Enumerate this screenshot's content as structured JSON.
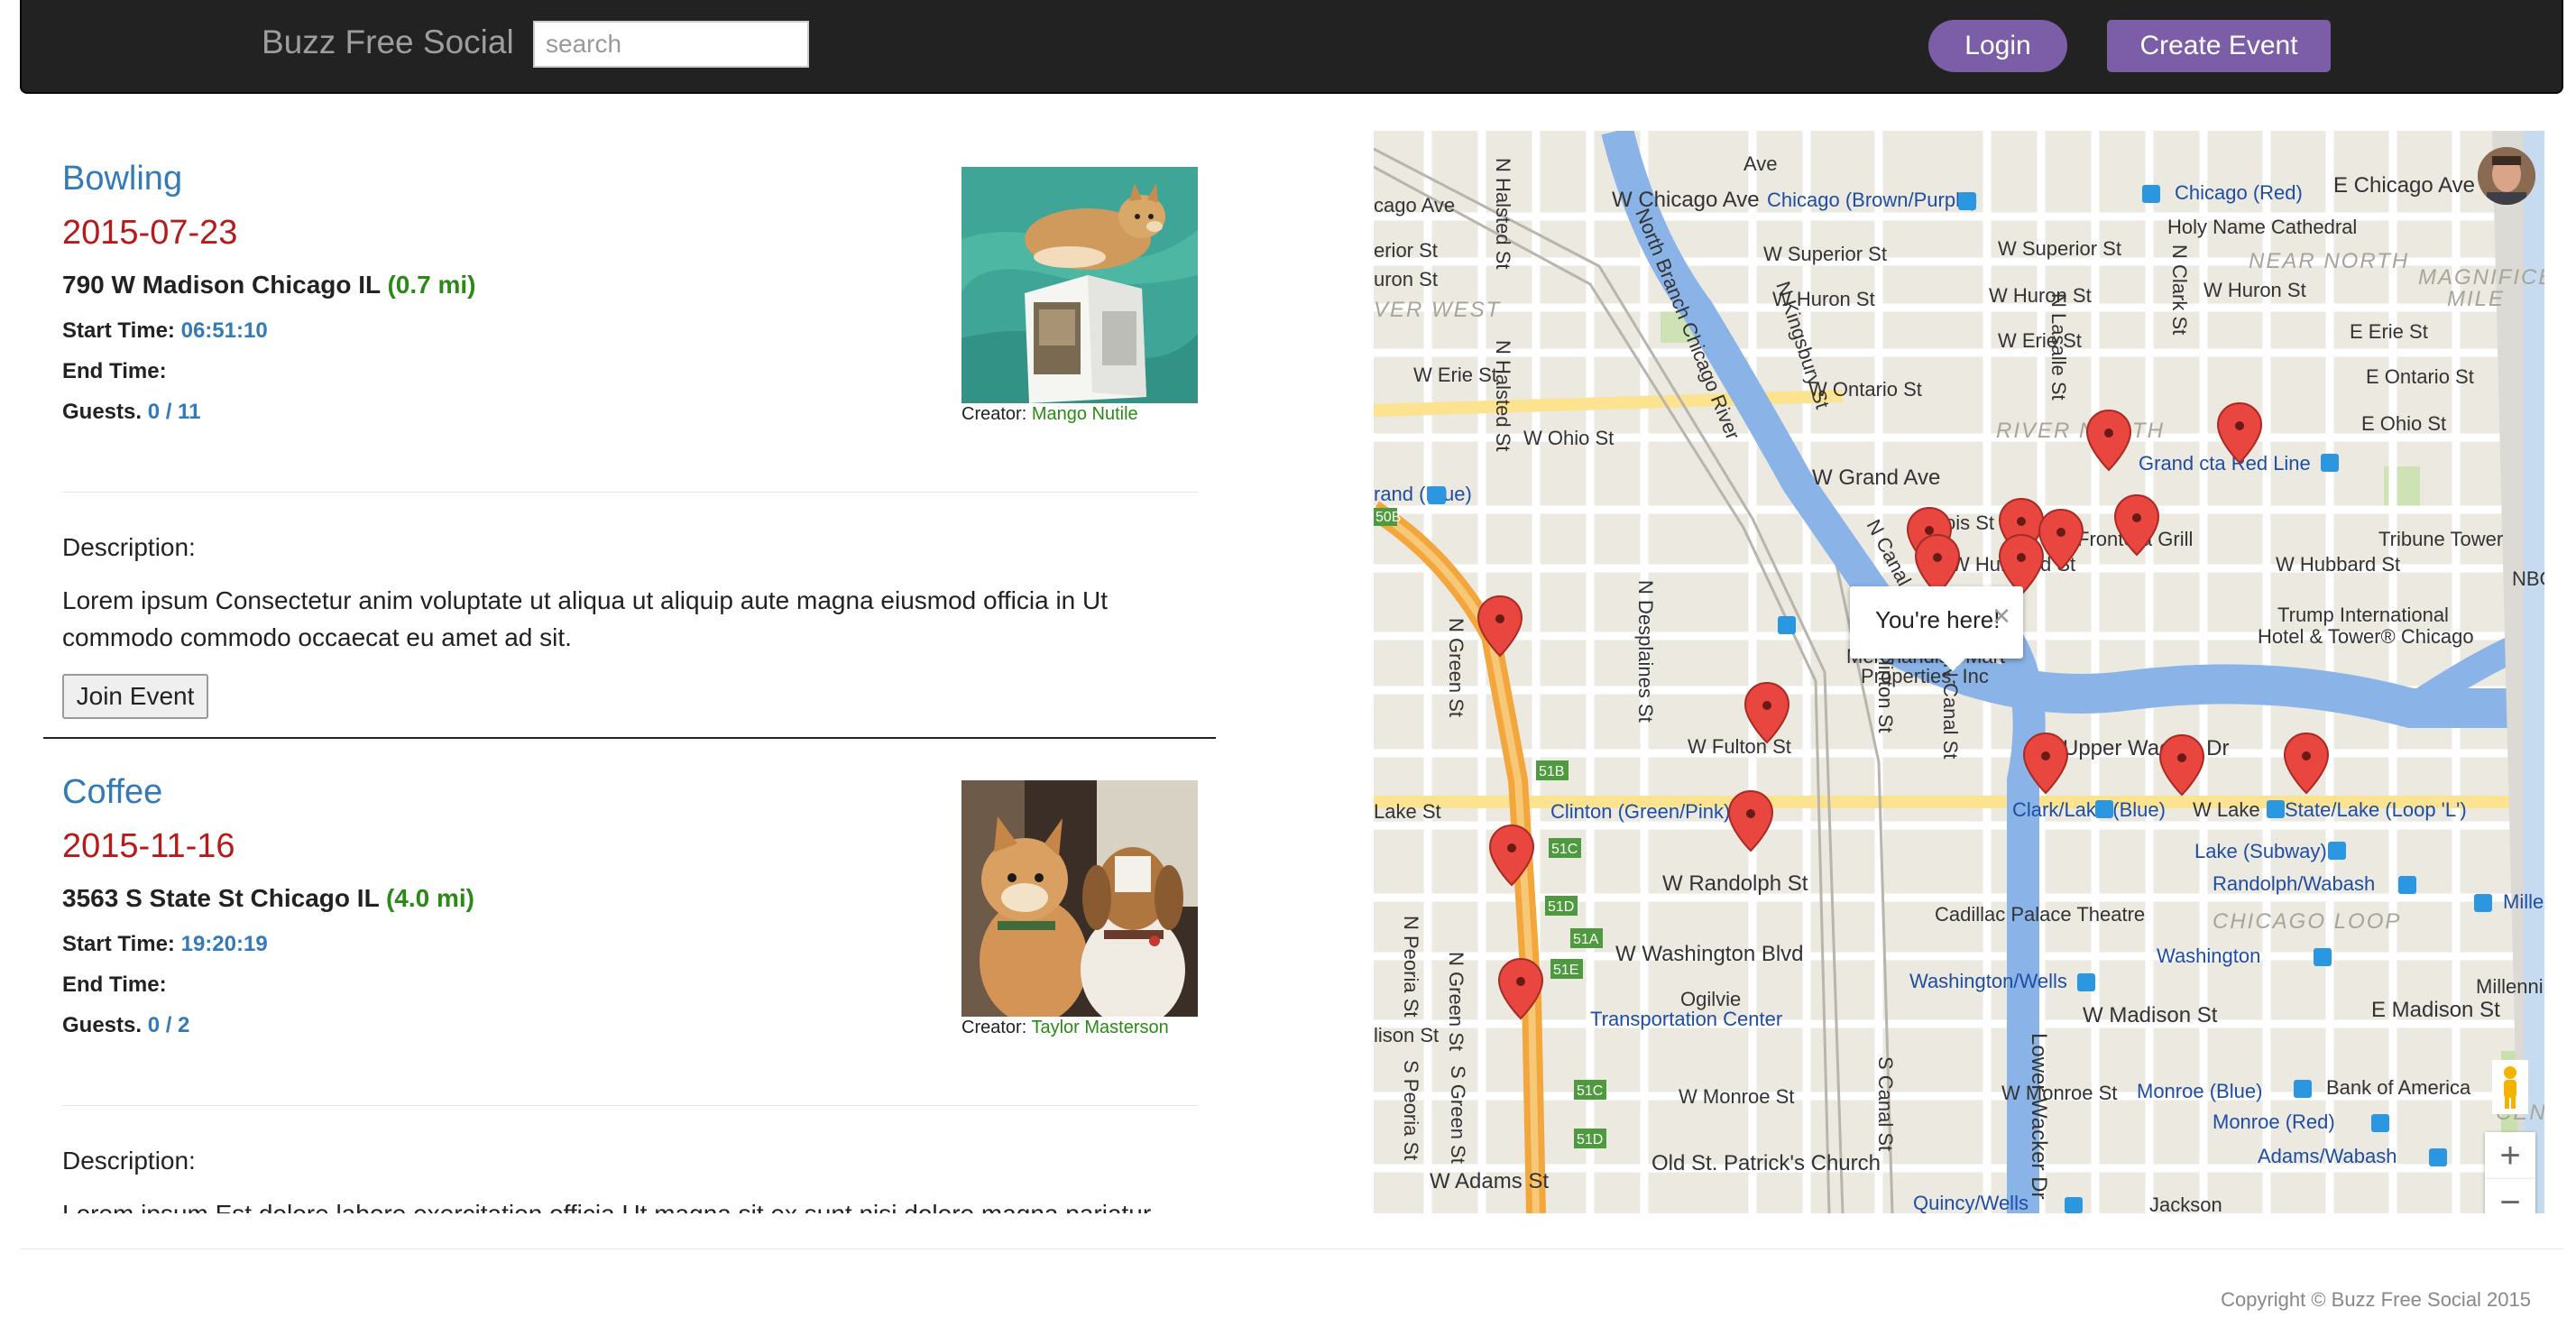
{
  "navbar": {
    "brand": "Buzz Free Social",
    "search_placeholder": "search",
    "login_label": "Login",
    "create_event_label": "Create Event"
  },
  "events": [
    {
      "title": "Bowling",
      "date": "2015-07-23",
      "address": "790 W Madison Chicago IL",
      "distance": "(0.7 mi)",
      "start_label": "Start Time:",
      "start_time": "06:51:10",
      "end_label": "End Time:",
      "end_time": "",
      "guests_label": "Guests.",
      "guests": "0 / 11",
      "creator_label": "Creator:",
      "creator": "Mango Nutile",
      "description_heading": "Description:",
      "description": "Lorem ipsum Consectetur anim voluptate ut aliqua ut aliquip aute magna eiusmod officia in Ut commodo commodo occaecat eu amet ad sit.",
      "join_label": "Join Event"
    },
    {
      "title": "Coffee",
      "date": "2015-11-16",
      "address": "3563 S State St Chicago IL",
      "distance": "(4.0 mi)",
      "start_label": "Start Time:",
      "start_time": "19:20:19",
      "end_label": "End Time:",
      "end_time": "",
      "guests_label": "Guests.",
      "guests": "0 / 2",
      "creator_label": "Creator:",
      "creator": "Taylor Masterson",
      "description_heading": "Description:",
      "description": "Lorem ipsum Est dolore labore exercitation officia Ut magna sit ex sunt nisi dolore magna pariatur",
      "join_label": "Join Event"
    }
  ],
  "map": {
    "popup_text": "You're here!",
    "popup_close": "×",
    "zoom_in": "+",
    "zoom_out": "−",
    "labels": {
      "w_chicago_ave": "W Chicago Ave",
      "chicago_brown": "Chicago (Brown/Purple)",
      "chicago_red": "Chicago (Red)",
      "e_chicago_ave": "E Chicago Ave",
      "holy_name": "Holy Name Cathedral",
      "near_north": "NEAR NORTH",
      "magnificent": "MAGNIFICE",
      "mile": "MILE",
      "w_superior": "W Superior St",
      "w_superior2": "W Superior St",
      "w_huron": "W Huron St",
      "w_huron2": "W Huron St",
      "w_huron3": "W Huron St",
      "w_erie": "W Erie St",
      "w_erie2": "W Erie St",
      "e_erie": "E Erie St",
      "e_ontario": "E Ontario St",
      "w_ontario": "W Ontario St",
      "w_ohio": "W Ohio St",
      "e_ohio": "E Ohio St",
      "river_north": "RIVER NORTH",
      "grand_red": "Grand cta Red Line",
      "grand_blue": "rand (Blue)",
      "w_grand": "W Grand Ave",
      "illinois": "Illinois St",
      "frontera": "Frontera Grill",
      "tribune": "Tribune Tower",
      "w_hubbard": "W Hubbard St",
      "w_hubbard2": "W Hubbard St",
      "nbc": "NBC",
      "trump1": "Trump International",
      "trump2": "Hotel & Tower® Chicago",
      "merch1": "Merchandise Mart",
      "merch2": "Properties, Inc",
      "w_fulton": "W Fulton St",
      "upper_wacker": "Upper Wacker Dr",
      "clark_lake": "Clark/Lake (Blue)",
      "w_lake": "W Lake St",
      "state_lake": "State/Lake (Loop 'L')",
      "lake_st": "Lake St",
      "clinton": "Clinton (Green/Pink)",
      "lake_subway": "Lake (Subway)",
      "randolph_wabash": "Randolph/Wabash",
      "millen": "Millen",
      "w_randolph": "W Randolph St",
      "cadillac": "Cadillac Palace Theatre",
      "chicago_loop": "CHICAGO LOOP",
      "washington": "Washington",
      "w_washington": "W Washington Blvd",
      "millennium": "Millennium Park",
      "washington_wells": "Washington/Wells",
      "ogilvie1": "Ogilvie",
      "ogilvie2": "Transportation Center",
      "w_madison": "W Madison St",
      "e_madison": "E Madison St",
      "lison": "lison St",
      "monroe_blue": "Monroe (Blue)",
      "bank_america": "Bank of America",
      "centr": "CENTR",
      "w_monroe": "W Monroe St",
      "w_monroe2": "W Monroe St",
      "monroe_red": "Monroe (Red)",
      "w_adams": "W Adams St",
      "old_st_patrick": "Old St. Patrick's Church",
      "adams_wabash": "Adams/Wabash",
      "quincy": "Quincy/Wells",
      "jackson": "Jackson",
      "ver_west": "VER WEST",
      "cago_ave": "cago Ave",
      "erior_st": "erior St",
      "uron_st": "uron St",
      "w_erie_left": "W Erie St",
      "n_halsted": "N Halsted St",
      "n_halsted2": "N Halsted St",
      "north_branch": "North Branch Chicago River",
      "n_kingsbury": "N Kingsbury St",
      "n_canal": "N Canal St",
      "n_canal2": "N Canal St",
      "n_clinton": "N Clinton St",
      "n_desplaines": "N Desplaines St",
      "n_green": "N Green St",
      "n_green2": "N Green St",
      "n_peoria": "N Peoria St",
      "s_peoria": "S Peoria St",
      "s_green": "S Green St",
      "s_canal": "S Canal St",
      "lower_wacker": "Lower Wacker Dr",
      "n_lasalle": "N Lasalle St",
      "n_clark": "N Clark St",
      "ave": "Ave",
      "x51b": "51B",
      "x51c": "51C",
      "x51d": "51D",
      "x51a": "51A",
      "x51e": "51E",
      "x51c2": "51C",
      "x51d2": "51D",
      "x50b": "50B"
    }
  },
  "footer": {
    "copyright": "Copyright © Buzz Free Social 2015"
  },
  "colors": {
    "navbar_bg": "#222222",
    "accent_purple": "#7b5ea7",
    "link_blue": "#337ab7",
    "date_red": "#b41c1c",
    "distance_green": "#2a8a16",
    "river_blue": "#8ab3e8",
    "marker_red": "#e8463e"
  }
}
